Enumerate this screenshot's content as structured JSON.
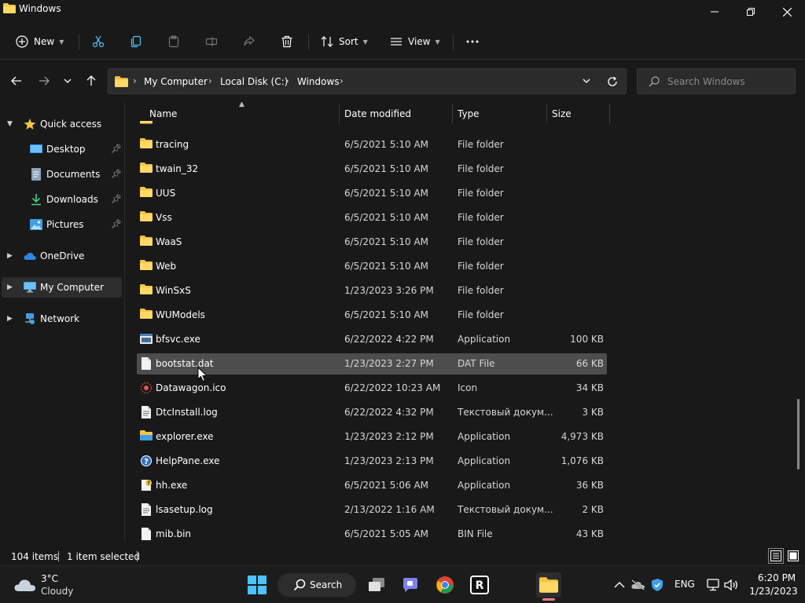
{
  "window": {
    "title": "Windows"
  },
  "toolbar": {
    "new_label": "New",
    "sort_label": "Sort",
    "view_label": "View",
    "more_label": "···"
  },
  "address": {
    "crumbs": [
      "My Computer",
      "Local Disk (C:)",
      "Windows"
    ]
  },
  "search": {
    "placeholder": "Search Windows"
  },
  "sidebar": {
    "items": [
      {
        "label": "Quick access"
      },
      {
        "label": "Desktop"
      },
      {
        "label": "Documents"
      },
      {
        "label": "Downloads"
      },
      {
        "label": "Pictures"
      },
      {
        "label": "OneDrive"
      },
      {
        "label": "My Computer"
      },
      {
        "label": "Network"
      }
    ]
  },
  "columns": {
    "name": "Name",
    "date": "Date modified",
    "type": "Type",
    "size": "Size"
  },
  "files": [
    {
      "name": "tracing",
      "date": "6/5/2021 5:10 AM",
      "type": "File folder",
      "size": "",
      "icon": "folder-icon"
    },
    {
      "name": "twain_32",
      "date": "6/5/2021 5:10 AM",
      "type": "File folder",
      "size": "",
      "icon": "folder-icon"
    },
    {
      "name": "UUS",
      "date": "6/5/2021 5:10 AM",
      "type": "File folder",
      "size": "",
      "icon": "folder-icon"
    },
    {
      "name": "Vss",
      "date": "6/5/2021 5:10 AM",
      "type": "File folder",
      "size": "",
      "icon": "folder-icon"
    },
    {
      "name": "WaaS",
      "date": "6/5/2021 5:10 AM",
      "type": "File folder",
      "size": "",
      "icon": "folder-icon"
    },
    {
      "name": "Web",
      "date": "6/5/2021 5:10 AM",
      "type": "File folder",
      "size": "",
      "icon": "folder-icon"
    },
    {
      "name": "WinSxS",
      "date": "1/23/2023 3:26 PM",
      "type": "File folder",
      "size": "",
      "icon": "folder-icon"
    },
    {
      "name": "WUModels",
      "date": "6/5/2021 5:10 AM",
      "type": "File folder",
      "size": "",
      "icon": "folder-icon"
    },
    {
      "name": "bfsvc.exe",
      "date": "6/22/2022 4:22 PM",
      "type": "Application",
      "size": "100 KB",
      "icon": "exe-icon"
    },
    {
      "name": "bootstat.dat",
      "date": "1/23/2023 2:27 PM",
      "type": "DAT File",
      "size": "66 KB",
      "icon": "file-icon"
    },
    {
      "name": "Datawagon.ico",
      "date": "6/22/2022 10:23 AM",
      "type": "Icon",
      "size": "34 KB",
      "icon": "ico-icon"
    },
    {
      "name": "DtcInstall.log",
      "date": "6/22/2022 4:32 PM",
      "type": "Текстовый докум...",
      "size": "3 KB",
      "icon": "text-file-icon"
    },
    {
      "name": "explorer.exe",
      "date": "1/23/2023 2:12 PM",
      "type": "Application",
      "size": "4,973 KB",
      "icon": "explorer-icon"
    },
    {
      "name": "HelpPane.exe",
      "date": "1/23/2023 2:13 PM",
      "type": "Application",
      "size": "1,076 KB",
      "icon": "help-icon"
    },
    {
      "name": "hh.exe",
      "date": "6/5/2021 5:06 AM",
      "type": "Application",
      "size": "36 KB",
      "icon": "hh-icon"
    },
    {
      "name": "lsasetup.log",
      "date": "2/13/2022 1:16 AM",
      "type": "Текстовый докум...",
      "size": "2 KB",
      "icon": "text-file-icon"
    },
    {
      "name": "mib.bin",
      "date": "6/5/2021 5:05 AM",
      "type": "BIN File",
      "size": "43 KB",
      "icon": "file-icon"
    }
  ],
  "selected_file": "bootstat.dat",
  "status": {
    "items": "104 items",
    "selected": "1 item selected"
  },
  "taskbar": {
    "weather_temp": "3°C",
    "weather_desc": "Cloudy",
    "search_label": "Search",
    "lang": "ENG",
    "time": "6:20 PM",
    "date": "1/23/2023"
  },
  "colors": {
    "accent": "#4cc2ff",
    "folder": "#f5c542",
    "selection": "#4d4d4d",
    "background": "#191919"
  }
}
